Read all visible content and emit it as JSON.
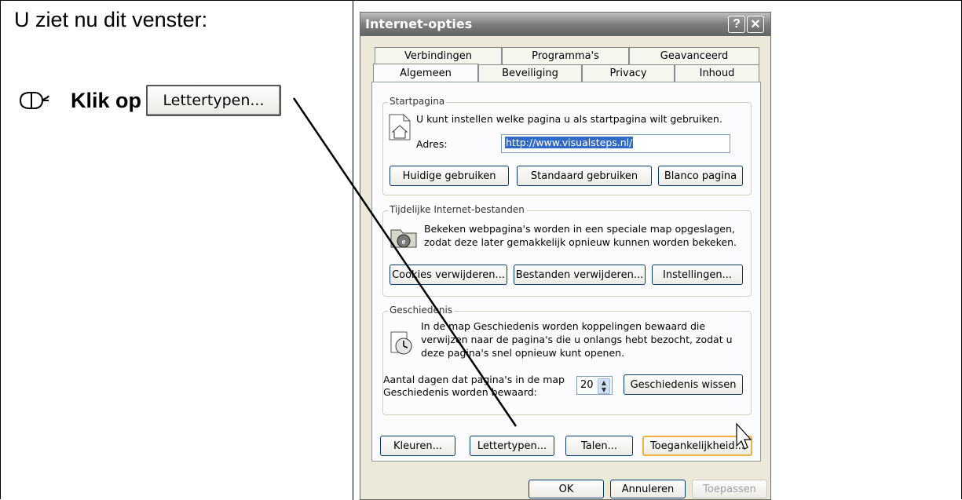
{
  "page": {
    "heading": "U ziet nu dit venster:",
    "instruction_prefix": "Klik op",
    "instruction_button": "Lettertypen..."
  },
  "icons": {
    "mouse": "mouse-icon",
    "home_page": "home-page-icon",
    "temp_files": "internet-explorer-folder-icon",
    "history": "history-clock-icon",
    "cursor": "mouse-cursor-icon"
  },
  "dialog": {
    "title": "Internet-opties",
    "help_label": "?",
    "close_label": "✕",
    "tabs_back": [
      "Verbindingen",
      "Programma's",
      "Geavanceerd"
    ],
    "tabs_front": [
      "Algemeen",
      "Beveiliging",
      "Privacy",
      "Inhoud"
    ],
    "startpage": {
      "label": "Startpagina",
      "description": "U kunt instellen welke pagina u als startpagina wilt gebruiken.",
      "address_label": "Adres:",
      "address_value": "http://www.visualsteps.nl/",
      "btn_current": "Huidige gebruiken",
      "btn_default": "Standaard gebruiken",
      "btn_blank": "Blanco pagina"
    },
    "tempfiles": {
      "label": "Tijdelijke Internet-bestanden",
      "line1": "Bekeken webpagina's worden in een speciale map opgeslagen,",
      "line2": "zodat deze later gemakkelijk opnieuw kunnen worden bekeken.",
      "btn_cookies": "Cookies verwijderen...",
      "btn_files": "Bestanden verwijderen...",
      "btn_settings": "Instellingen..."
    },
    "history": {
      "label": "Geschiedenis",
      "line1": "In de map Geschiedenis worden koppelingen bewaard die",
      "line2": "verwijzen naar de pagina's die u onlangs hebt bezocht, zodat u",
      "line3": "deze pagina's snel opnieuw kunt openen.",
      "days_line1": "Aantal dagen dat pagina's in de map",
      "days_line2": "Geschiedenis worden bewaard:",
      "days_value": "20",
      "btn_clear": "Geschiedenis wissen"
    },
    "bottom_buttons": {
      "colors": "Kleuren...",
      "fonts": "Lettertypen...",
      "languages": "Talen...",
      "accessibility": "Toegankelijkheid..."
    },
    "footer": {
      "ok": "OK",
      "cancel": "Annuleren",
      "apply": "Toepassen"
    }
  }
}
